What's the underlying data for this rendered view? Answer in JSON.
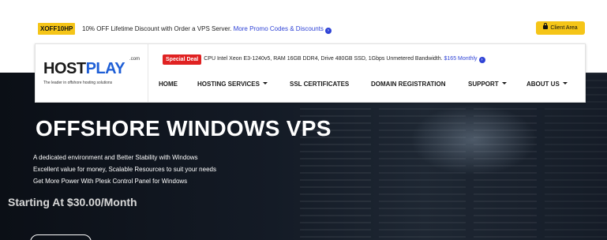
{
  "promo": {
    "code": "XOFF10HP",
    "text": "10% OFF Lifetime Discount with Order a VPS Server.",
    "link": "More Promo Codes & Discounts",
    "client_area": "Client Area"
  },
  "logo": {
    "host": "HOST",
    "play": "PLAY",
    "com": ".com",
    "tagline": "The leader in offshore hosting solutions"
  },
  "deal": {
    "badge": "Special Deal",
    "text": "CPU Intel Xeon E3-1240v5, RAM 16GB DDR4, Drive 480GB SSD, 1Gbps Unmetered Bandwidth.",
    "price_link": "$165 Monthly"
  },
  "nav": {
    "items": [
      {
        "label": "HOME",
        "dropdown": false
      },
      {
        "label": "HOSTING SERVICES",
        "dropdown": true
      },
      {
        "label": "SSL CERTIFICATES",
        "dropdown": false
      },
      {
        "label": "DOMAIN REGISTRATION",
        "dropdown": false
      },
      {
        "label": "SUPPORT",
        "dropdown": true
      },
      {
        "label": "ABOUT US",
        "dropdown": true
      }
    ]
  },
  "hero": {
    "title": "OFFSHORE WINDOWS VPS",
    "lines": [
      "A dedicated environment and Better Stability with Windows",
      "Excellent value for money, Scalable Resources to suit your needs",
      "Get More Power With Plesk Control Panel for Windows"
    ],
    "price": "Starting At $30.00/Month"
  },
  "colors": {
    "accent_yellow": "#f5c518",
    "link_blue": "#2f43d6",
    "deal_red": "#e02222",
    "logo_blue": "#1f5fd6"
  }
}
